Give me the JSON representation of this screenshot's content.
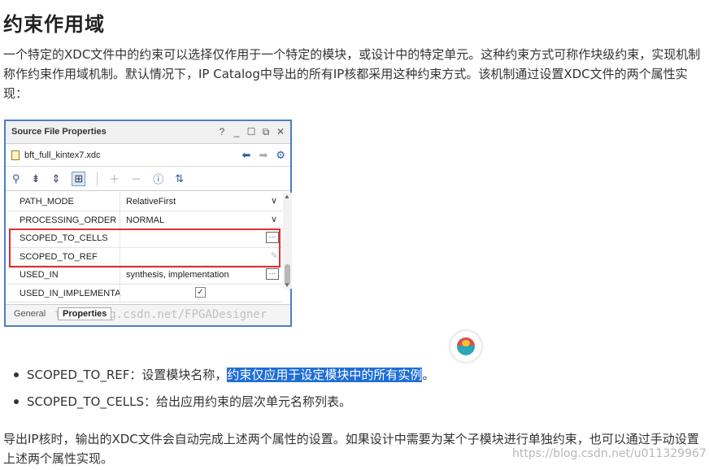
{
  "article": {
    "title": "约束作用域",
    "para1": "一个特定的XDC文件中的约束可以选择仅作用于一个特定的模块，或设计中的特定单元。这种约束方式可称作块级约束，实现机制称作约束作用域机制。默认情况下，IP Catalog中导出的所有IP核都采用这种约束方式。该机制通过设置XDC文件的两个属性实现：",
    "bullets": [
      {
        "prefix": "SCOPED_TO_REF：设置模块名称，",
        "highlight": "约束仅应用于设定模块中的所有实例",
        "suffix": "。"
      },
      {
        "prefix": "SCOPED_TO_CELLS：给出应用约束的层次单元名称列表。",
        "highlight": "",
        "suffix": ""
      }
    ],
    "para2": "导出IP核时，输出的XDC文件会自动完成上述两个属性的设置。如果设计中需要为某个子模块进行单独约束，也可以通过手动设置上述两个属性实现。",
    "watermark": "https://blog.csdn.net/u011329967"
  },
  "panel": {
    "title": "Source File Properties",
    "controls": [
      "?",
      "_",
      "☐",
      "⧉",
      "✕"
    ],
    "filename": "bft_full_kintex7.xdc",
    "rows": [
      {
        "key": "PATH_MODE",
        "value": "RelativeFirst",
        "widget": "dropdown"
      },
      {
        "key": "PROCESSING_ORDER",
        "value": "NORMAL",
        "widget": "dropdown"
      },
      {
        "key": "SCOPED_TO_CELLS",
        "value": "",
        "widget": "ellipsis"
      },
      {
        "key": "SCOPED_TO_REF",
        "value": "",
        "widget": "pencil"
      },
      {
        "key": "USED_IN",
        "value": "synthesis, implementation",
        "widget": "ellipsis"
      },
      {
        "key": "USED_IN_IMPLEMENTA",
        "value": "",
        "widget": "checkbox"
      }
    ],
    "tabs": [
      "General",
      "Properties"
    ],
    "active_tab": "Properties",
    "watermark": "tt://blog.csdn.net/FPGADesigner",
    "highlight_color": "#e03030"
  }
}
